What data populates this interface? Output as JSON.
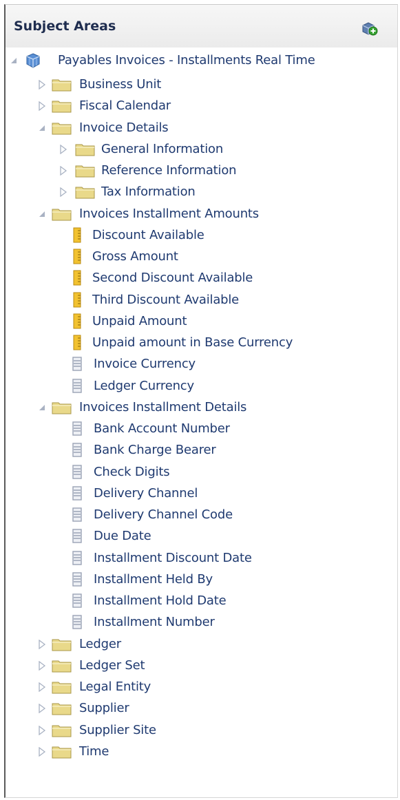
{
  "panel": {
    "title": "Subject Areas",
    "add_button_icon": "add-subject-area-icon"
  },
  "tree": {
    "root": {
      "label": "Payables Invoices - Installments Real Time",
      "expanded": true
    },
    "nodes": [
      {
        "label": "Business Unit",
        "type": "folder",
        "level": 1,
        "expanded": false
      },
      {
        "label": "Fiscal Calendar",
        "type": "folder",
        "level": 1,
        "expanded": false
      },
      {
        "label": "Invoice Details",
        "type": "folder",
        "level": 1,
        "expanded": true
      },
      {
        "label": "General Information",
        "type": "folder",
        "level": 2,
        "expanded": false
      },
      {
        "label": "Reference Information",
        "type": "folder",
        "level": 2,
        "expanded": false
      },
      {
        "label": "Tax Information",
        "type": "folder",
        "level": 2,
        "expanded": false
      },
      {
        "label": "Invoices Installment Amounts",
        "type": "folder",
        "level": 1,
        "expanded": true
      },
      {
        "label": "Discount Available",
        "type": "measure",
        "level": 2
      },
      {
        "label": "Gross Amount",
        "type": "measure",
        "level": 2
      },
      {
        "label": "Second Discount Available",
        "type": "measure",
        "level": 2
      },
      {
        "label": "Third Discount Available",
        "type": "measure",
        "level": 2
      },
      {
        "label": "Unpaid Amount",
        "type": "measure",
        "level": 2
      },
      {
        "label": "Unpaid amount in Base Currency",
        "type": "measure",
        "level": 2
      },
      {
        "label": "Invoice Currency",
        "type": "attribute",
        "level": 2
      },
      {
        "label": "Ledger Currency",
        "type": "attribute",
        "level": 2
      },
      {
        "label": "Invoices Installment Details",
        "type": "folder",
        "level": 1,
        "expanded": true
      },
      {
        "label": "Bank Account Number",
        "type": "attribute",
        "level": 2
      },
      {
        "label": "Bank Charge Bearer",
        "type": "attribute",
        "level": 2
      },
      {
        "label": "Check Digits",
        "type": "attribute",
        "level": 2
      },
      {
        "label": "Delivery Channel",
        "type": "attribute",
        "level": 2
      },
      {
        "label": "Delivery Channel Code",
        "type": "attribute",
        "level": 2
      },
      {
        "label": "Due Date",
        "type": "attribute",
        "level": 2
      },
      {
        "label": "Installment Discount Date",
        "type": "attribute",
        "level": 2
      },
      {
        "label": "Installment Held By",
        "type": "attribute",
        "level": 2
      },
      {
        "label": "Installment Hold Date",
        "type": "attribute",
        "level": 2
      },
      {
        "label": "Installment Number",
        "type": "attribute",
        "level": 2
      },
      {
        "label": "Ledger",
        "type": "folder",
        "level": 1,
        "expanded": false
      },
      {
        "label": "Ledger Set",
        "type": "folder",
        "level": 1,
        "expanded": false
      },
      {
        "label": "Legal Entity",
        "type": "folder",
        "level": 1,
        "expanded": false
      },
      {
        "label": "Supplier",
        "type": "folder",
        "level": 1,
        "expanded": false
      },
      {
        "label": "Supplier Site",
        "type": "folder",
        "level": 1,
        "expanded": false
      },
      {
        "label": "Time",
        "type": "folder",
        "level": 1,
        "expanded": false
      }
    ]
  },
  "colors": {
    "text": "#1f3a70",
    "folder": "#e9d98a",
    "measure": "#f2c230",
    "attribute": "#9aa2b5",
    "toggle": "#a9b2c3"
  }
}
